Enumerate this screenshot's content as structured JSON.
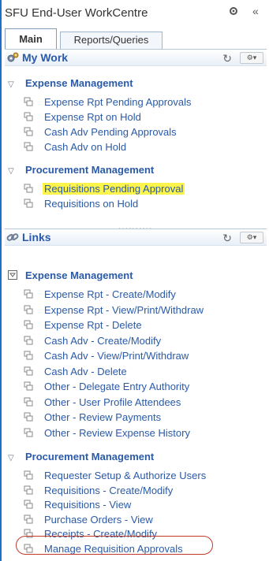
{
  "window": {
    "title": "SFU End-User WorkCentre",
    "icons": {
      "settings": "gear-icon",
      "collapse": "double-chevron-left-icon"
    }
  },
  "tabs": [
    {
      "label": "Main",
      "active": true
    },
    {
      "label": "Reports/Queries",
      "active": false
    }
  ],
  "my_work": {
    "title": "My Work",
    "sections": [
      {
        "title": "Expense Management",
        "items": [
          "Expense Rpt Pending Approvals",
          "Expense Rpt on Hold",
          "Cash Adv Pending Approvals",
          "Cash Adv on Hold"
        ]
      },
      {
        "title": "Procurement Management",
        "items": [
          "Requisitions Pending Approval",
          "Requisitions on Hold"
        ],
        "highlighted": "Requisitions Pending Approval",
        "highlight_color": "#fdf44c"
      }
    ]
  },
  "divider_dots": "..........",
  "links": {
    "title": "Links",
    "sections": [
      {
        "title": "Expense Management",
        "items": [
          "Expense Rpt - Create/Modify",
          "Expense Rpt - View/Print/Withdraw",
          "Expense Rpt - Delete",
          "Cash Adv - Create/Modify",
          "Cash Adv - View/Print/Withdraw",
          "Cash Adv - Delete",
          "Other - Delegate Entry Authority",
          "Other - User Profile Attendees",
          "Other - Review Payments",
          "Other - Review Expense History"
        ]
      },
      {
        "title": "Procurement Management",
        "items": [
          "Requester Setup & Authorize Users",
          "Requisitions - Create/Modify",
          "Requisitions - View",
          "Purchase Orders - View",
          "Receipts - Create/Modify",
          "Manage Requisition Approvals"
        ],
        "circled": "Manage Requisition Approvals",
        "circle_color": "#c0392b"
      }
    ]
  },
  "colors": {
    "link": "#2a5aa8",
    "accent_border": "#1e6fc8"
  }
}
